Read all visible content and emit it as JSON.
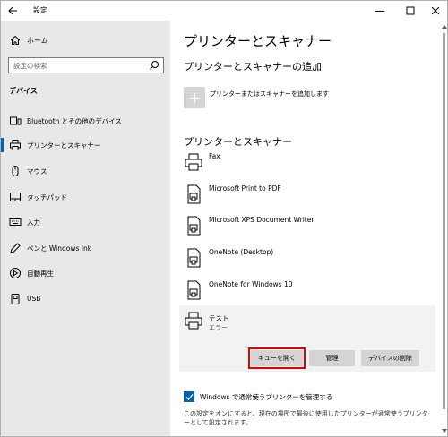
{
  "window": {
    "title": "設定"
  },
  "sidebar": {
    "home_label": "ホーム",
    "search_placeholder": "設定の検索",
    "section_title": "デバイス",
    "items": [
      {
        "label": "Bluetooth とその他のデバイス",
        "icon": "bluetooth-icon"
      },
      {
        "label": "プリンターとスキャナー",
        "icon": "printer-icon",
        "active": true
      },
      {
        "label": "マウス",
        "icon": "mouse-icon"
      },
      {
        "label": "タッチパッド",
        "icon": "touchpad-icon"
      },
      {
        "label": "入力",
        "icon": "keyboard-icon"
      },
      {
        "label": "ペンと Windows Ink",
        "icon": "pen-icon"
      },
      {
        "label": "自動再生",
        "icon": "autoplay-icon"
      },
      {
        "label": "USB",
        "icon": "usb-icon"
      }
    ]
  },
  "main": {
    "page_title": "プリンターとスキャナー",
    "add_section_title": "プリンターとスキャナーの追加",
    "add_label": "プリンターまたはスキャナーを追加します",
    "list_section_title": "プリンターとスキャナー",
    "printers": [
      {
        "name": "Fax",
        "icon": "fax-icon"
      },
      {
        "name": "Microsoft Print to PDF",
        "icon": "printer-doc-icon"
      },
      {
        "name": "Microsoft XPS Document Writer",
        "icon": "printer-doc-icon"
      },
      {
        "name": "OneNote (Desktop)",
        "icon": "printer-doc-icon"
      },
      {
        "name": "OneNote for Windows 10",
        "icon": "printer-doc-icon"
      }
    ],
    "selected_printer": {
      "name": "テスト",
      "status": "エラー",
      "open_queue_label": "キューを開く",
      "manage_label": "管理",
      "remove_label": "デバイスの削除"
    },
    "default_checkbox": {
      "label": "Windows で通常使うプリンターを管理する",
      "checked": true
    },
    "note": "この設定をオンにすると、現在の場所で最後に使用したプリンターが通常使うプリンターとして設定されます。"
  },
  "colors": {
    "accent": "#0063b1",
    "sidebar_bg": "#e8e8e8",
    "highlight": "#e00000"
  }
}
